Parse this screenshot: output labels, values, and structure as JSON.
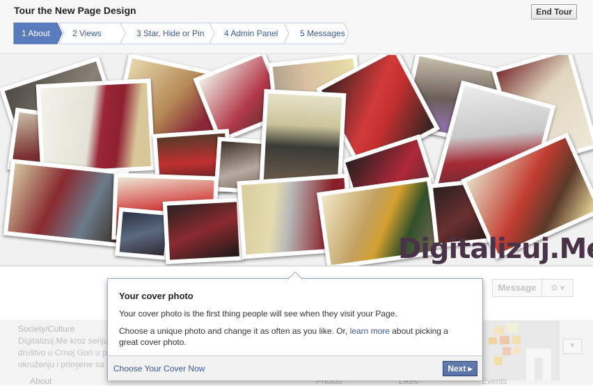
{
  "tour": {
    "title": "Tour the New Page Design",
    "end_label": "End Tour",
    "steps": [
      {
        "label": "1 About",
        "active": true
      },
      {
        "label": "2 Views",
        "active": false
      },
      {
        "label": "3 Star, Hide or Pin",
        "active": false
      },
      {
        "label": "4 Admin Panel",
        "active": false
      },
      {
        "label": "5 Messages",
        "active": false
      }
    ]
  },
  "cover": {
    "brand_text": "Digitalizuj.Me"
  },
  "page": {
    "message_label": "Message",
    "gear_icon": "gear-icon",
    "category": "Society/Culture",
    "description": "Digitalizuj.Me kroz seriju društvo u Crnoj Gori u p okruženju i primjene sa",
    "tabs": [
      "About",
      "Photos",
      "Likes",
      "Events"
    ]
  },
  "popup": {
    "title": "Your cover photo",
    "p1": "Your cover photo is the first thing people will see when they visit your Page.",
    "p2_before": "Choose a unique photo and change it as often as you like. Or, ",
    "p2_link": "learn more",
    "p2_after": " about picking a great cover photo.",
    "choose_label": "Choose Your Cover Now",
    "next_label": "Next ▸"
  },
  "colors": {
    "accent": "#3b5998",
    "active_step": "#5b7bbf",
    "brand_text": "#4a3348"
  }
}
